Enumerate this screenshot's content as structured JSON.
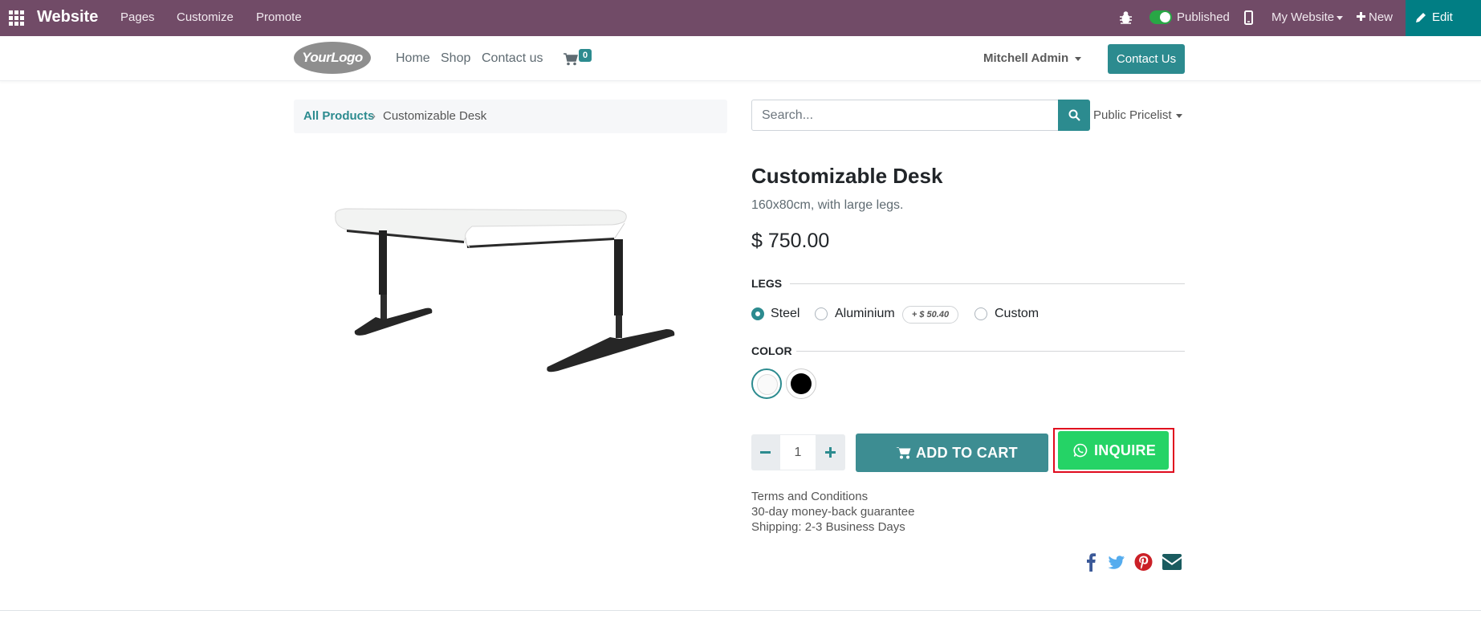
{
  "adminbar": {
    "brand": "Website",
    "menu": [
      "Pages",
      "Customize",
      "Promote"
    ],
    "published_label": "Published",
    "website_selector": "My Website",
    "new_label": "New",
    "edit_label": "Edit",
    "bg_color": "#714b67",
    "edit_bg_color": "#017e84"
  },
  "header": {
    "logo_text": "YourLogo",
    "nav": [
      "Home",
      "Shop",
      "Contact us"
    ],
    "cart_count": "0",
    "user": "Mitchell Admin",
    "contact_button": "Contact Us",
    "accent_color": "#2c8b8f"
  },
  "breadcrumb": {
    "parent": "All Products",
    "current": "Customizable Desk"
  },
  "search": {
    "placeholder": "Search...",
    "pricelist": "Public Pricelist"
  },
  "product": {
    "name": "Customizable Desk",
    "description": "160x80cm, with large legs.",
    "price": "$ 750.00",
    "attributes": {
      "legs": {
        "label": "LEGS",
        "options": [
          {
            "label": "Steel",
            "selected": true
          },
          {
            "label": "Aluminium",
            "selected": false,
            "extra": "+ $ 50.40"
          },
          {
            "label": "Custom",
            "selected": false
          }
        ]
      },
      "color": {
        "label": "COLOR",
        "options": [
          {
            "name": "white",
            "color": "#ffffff",
            "selected": true
          },
          {
            "name": "black",
            "color": "#000000",
            "selected": false
          }
        ]
      }
    },
    "quantity": "1",
    "add_to_cart_label": "ADD TO CART",
    "inquire_label": "INQUIRE",
    "inquire_color": "#25d366",
    "terms": [
      "Terms and Conditions",
      "30-day money-back guarantee",
      "Shipping: 2-3 Business Days"
    ],
    "share_icons": [
      "facebook-icon",
      "twitter-icon",
      "pinterest-icon",
      "email-icon"
    ]
  }
}
